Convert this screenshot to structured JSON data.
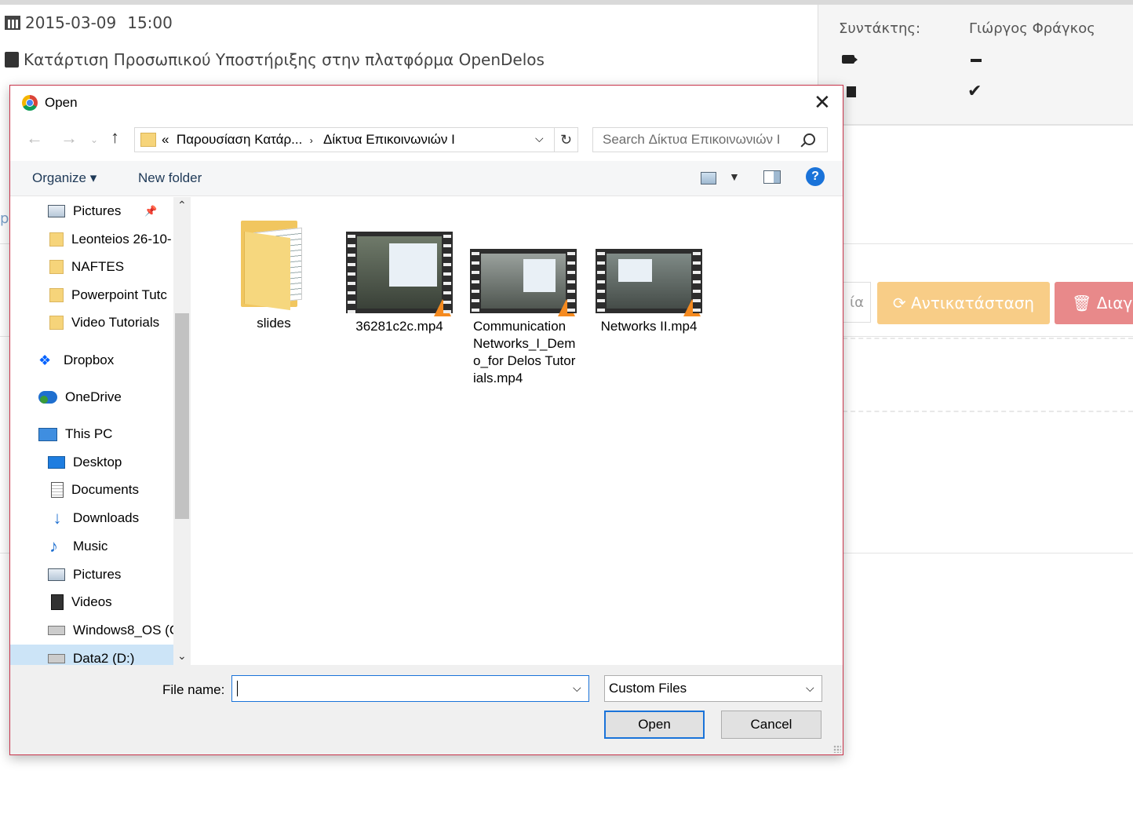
{
  "page": {
    "date": "2015-03-09",
    "time": "15:00",
    "course_title": "Κατάρτιση Προσωπικού Υποστήριξης στην πλατφόρμα OpenDelos",
    "author_label": "Συντάκτης:",
    "author_name": "Γιώργος Φράγκος",
    "edit_button_fragment": "ία",
    "replace_button": "Αντικατάσταση",
    "delete_button": "Διαγρ",
    "left_fragment": "p"
  },
  "dialog": {
    "title": "Open",
    "address": {
      "prefix": "«",
      "crumbs": [
        "Παρουσίαση Κατάρ...",
        "Δίκτυα Επικοινωνιών Ι"
      ]
    },
    "search_placeholder": "Search Δίκτυα Επικοινωνιών Ι",
    "toolbar": {
      "organize": "Organize ▾",
      "new_folder": "New folder"
    },
    "nav_items": [
      {
        "label": "Pictures",
        "icon": "pictures-icon"
      },
      {
        "label": "Leonteios 26-10-",
        "icon": "folder-icon"
      },
      {
        "label": "NAFTES",
        "icon": "folder-icon"
      },
      {
        "label": "Powerpoint Tutc",
        "icon": "folder-icon"
      },
      {
        "label": "Video Tutorials",
        "icon": "folder-icon"
      },
      {
        "label": "Dropbox",
        "icon": "dropbox-icon"
      },
      {
        "label": "OneDrive",
        "icon": "onedrive-icon"
      },
      {
        "label": "This PC",
        "icon": "this-pc-icon"
      },
      {
        "label": "Desktop",
        "icon": "desktop-icon"
      },
      {
        "label": "Documents",
        "icon": "documents-icon"
      },
      {
        "label": "Downloads",
        "icon": "downloads-icon"
      },
      {
        "label": "Music",
        "icon": "music-icon"
      },
      {
        "label": "Pictures",
        "icon": "pictures-icon"
      },
      {
        "label": "Videos",
        "icon": "videos-icon"
      },
      {
        "label": "Windows8_OS (C",
        "icon": "drive-icon"
      },
      {
        "label": "Data2 (D:)",
        "icon": "drive-icon"
      }
    ],
    "files": [
      {
        "name": "slides",
        "type": "folder"
      },
      {
        "name": "36281c2c.mp4",
        "type": "video"
      },
      {
        "name": "Communication Networks_I_Demo_for Delos Tutorials.mp4",
        "type": "video"
      },
      {
        "name": "Networks II.mp4",
        "type": "video"
      }
    ],
    "file_name_label": "File name:",
    "file_name_value": "",
    "filter": "Custom Files",
    "open_button": "Open",
    "cancel_button": "Cancel"
  }
}
